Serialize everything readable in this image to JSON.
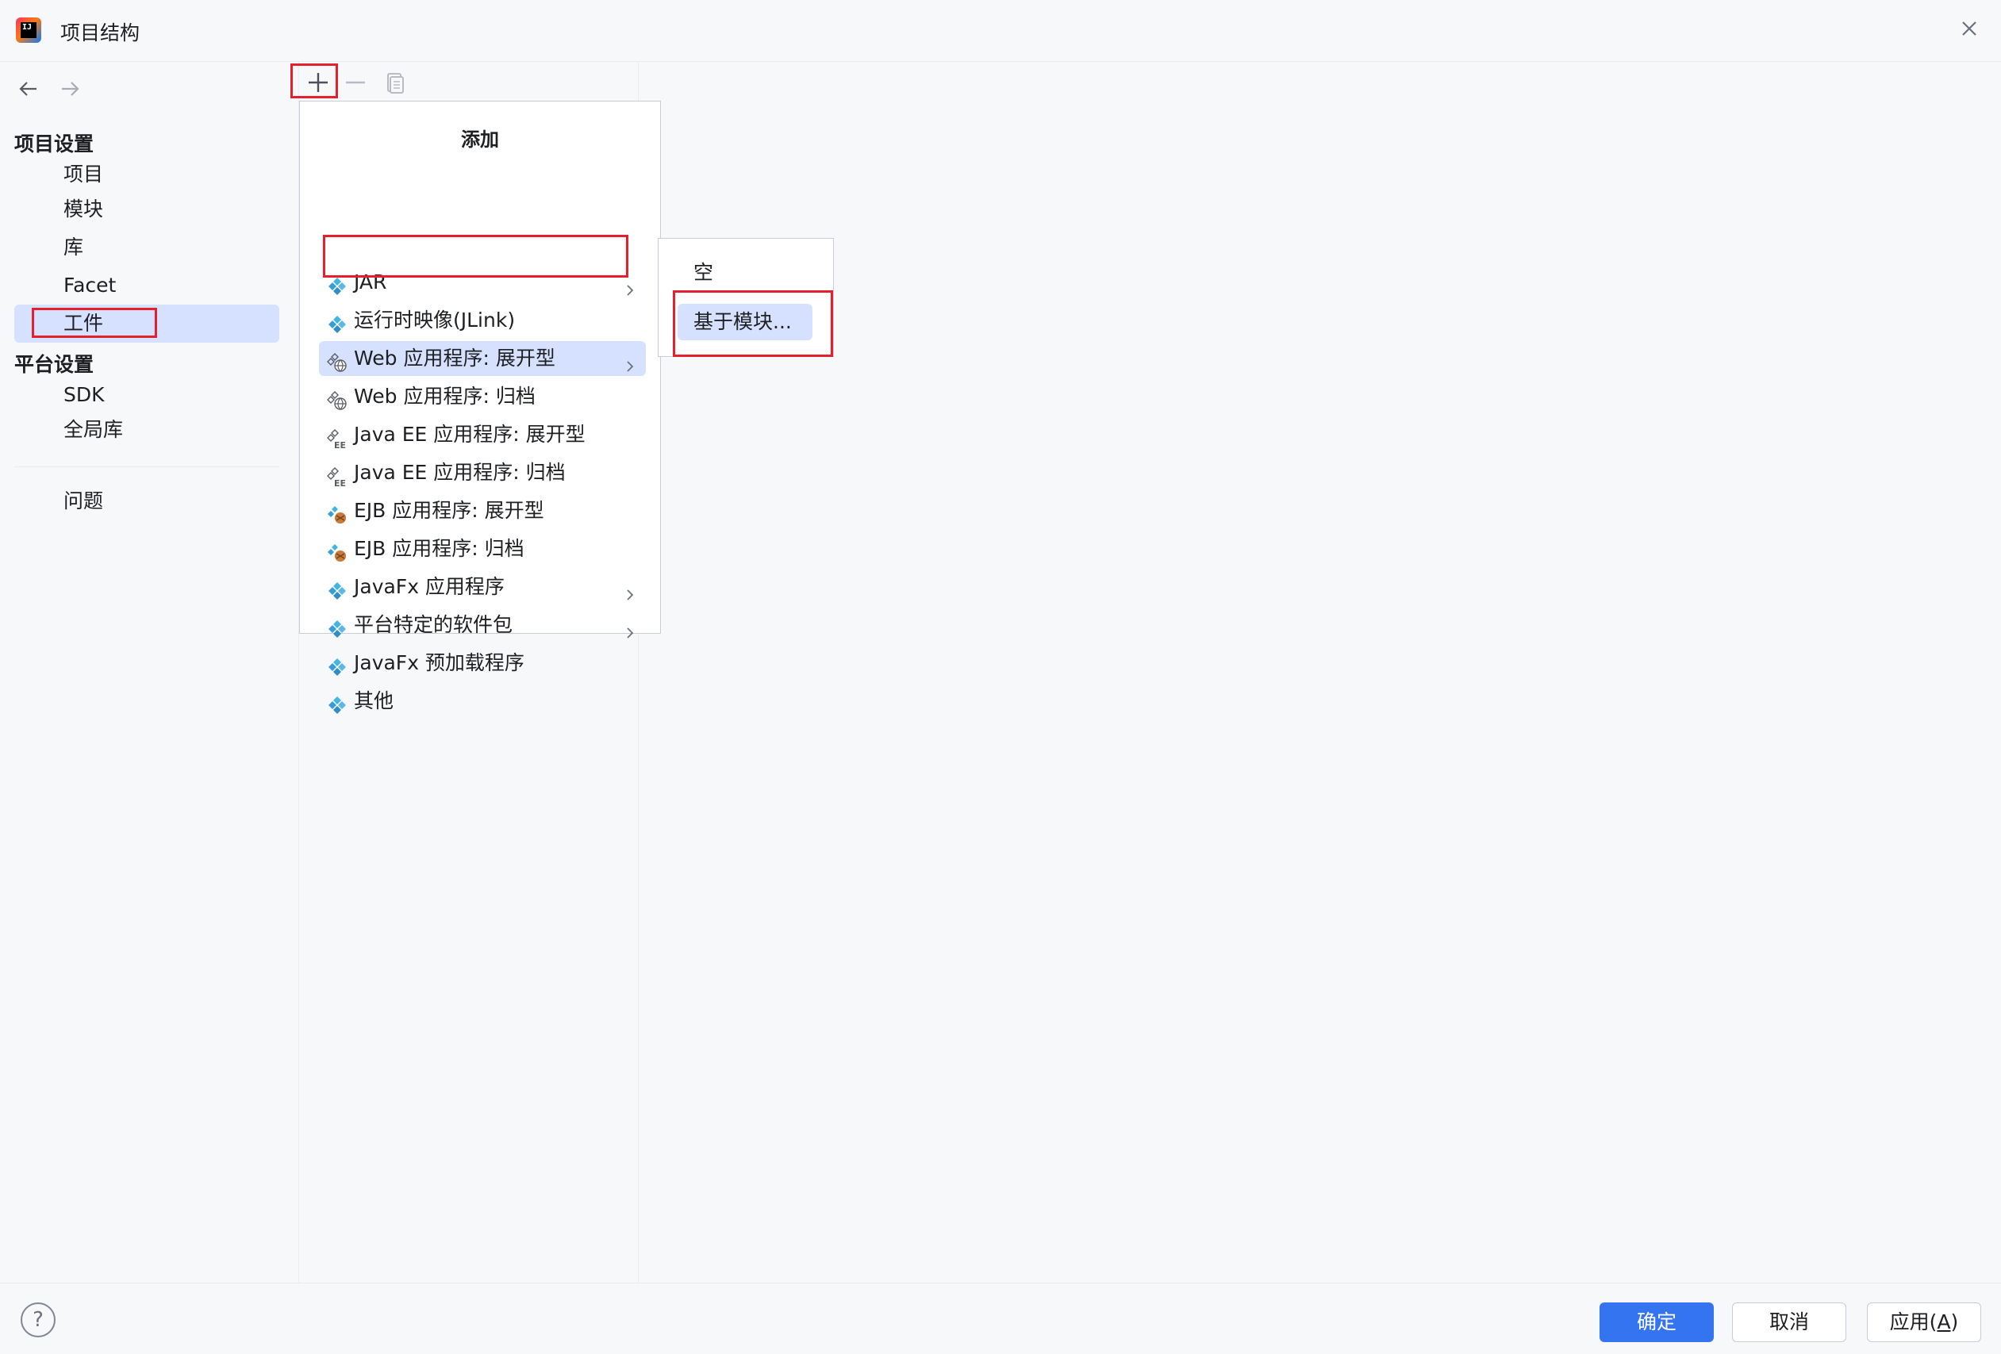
{
  "window": {
    "title": "项目结构",
    "logo_text": "IJ"
  },
  "sidebar": {
    "sections": [
      {
        "label": "项目设置"
      },
      {
        "label": "平台设置"
      }
    ],
    "items": [
      {
        "label": "项目"
      },
      {
        "label": "模块"
      },
      {
        "label": "库"
      },
      {
        "label": "Facet"
      },
      {
        "label": "工件"
      },
      {
        "label": "SDK"
      },
      {
        "label": "全局库"
      },
      {
        "label": "问题"
      }
    ],
    "selected": "工件"
  },
  "toolbar": {
    "add_icon": "plus-icon",
    "remove_icon": "minus-icon",
    "copy_icon": "copy-icon"
  },
  "popup": {
    "title": "添加",
    "items": [
      {
        "label": "JAR",
        "icon": "artifact-icon",
        "submenu": true
      },
      {
        "label": "运行时映像(JLink)",
        "icon": "artifact-icon",
        "submenu": false
      },
      {
        "label": "Web 应用程序: 展开型",
        "icon": "web-artifact-icon",
        "submenu": true
      },
      {
        "label": "Web 应用程序: 归档",
        "icon": "web-artifact-icon",
        "submenu": false
      },
      {
        "label": "Java EE 应用程序: 展开型",
        "icon": "javaee-artifact-icon",
        "submenu": false
      },
      {
        "label": "Java EE 应用程序: 归档",
        "icon": "javaee-artifact-icon",
        "submenu": false
      },
      {
        "label": "EJB 应用程序: 展开型",
        "icon": "ejb-artifact-icon",
        "submenu": false
      },
      {
        "label": "EJB 应用程序: 归档",
        "icon": "ejb-artifact-icon",
        "submenu": false
      },
      {
        "label": "JavaFx 应用程序",
        "icon": "artifact-icon",
        "submenu": true
      },
      {
        "label": "平台特定的软件包",
        "icon": "artifact-icon",
        "submenu": true
      },
      {
        "label": "JavaFx 预加载程序",
        "icon": "artifact-icon",
        "submenu": false
      },
      {
        "label": "其他",
        "icon": "artifact-icon",
        "submenu": false
      }
    ]
  },
  "submenu": {
    "items": [
      {
        "label": "空"
      },
      {
        "label": "基于模块..."
      }
    ]
  },
  "footer": {
    "help": "?",
    "ok": "确定",
    "cancel": "取消",
    "apply_prefix": "应用(",
    "apply_mnemonic": "A",
    "apply_suffix": ")"
  },
  "colors": {
    "accent": "#3574f0",
    "selection": "#d5e1ff",
    "annotation": "#e5202e"
  }
}
